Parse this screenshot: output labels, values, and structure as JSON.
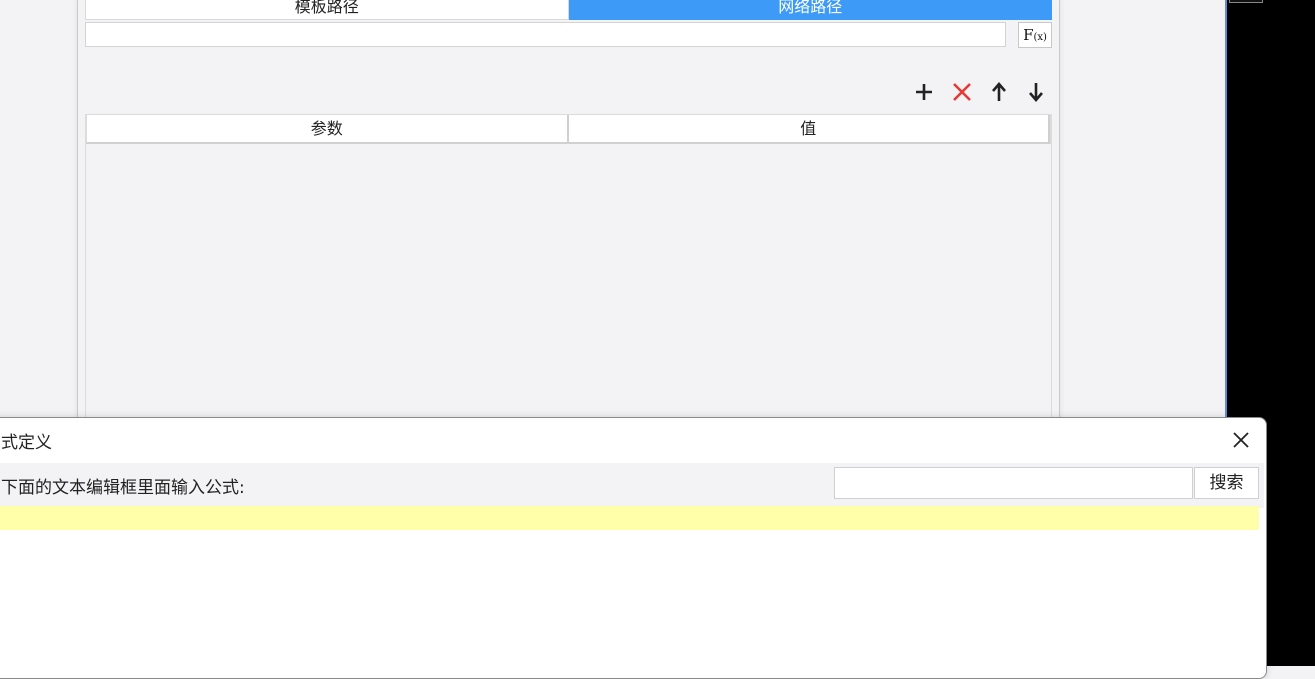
{
  "path_tabs": [
    "模板路径",
    "网络路径"
  ],
  "active_tab_index": 1,
  "url_input": {
    "value": ""
  },
  "fx_button": {
    "main": "F",
    "sub": "(x)"
  },
  "toolbar_icons": [
    "plus-icon",
    "delete-x-icon",
    "arrow-up-icon",
    "arrow-down-icon"
  ],
  "params_table": {
    "columns": [
      "参数",
      "值"
    ],
    "rows": []
  },
  "formula_dialog": {
    "title": "式定义",
    "instruction": "下面的文本编辑框里面输入公式:",
    "search_value": "",
    "search_button": "搜索",
    "formula_value": ""
  },
  "colors": {
    "accent": "#3d9af7",
    "delete": "#e53935",
    "editor_bg": "#ffffaa"
  }
}
